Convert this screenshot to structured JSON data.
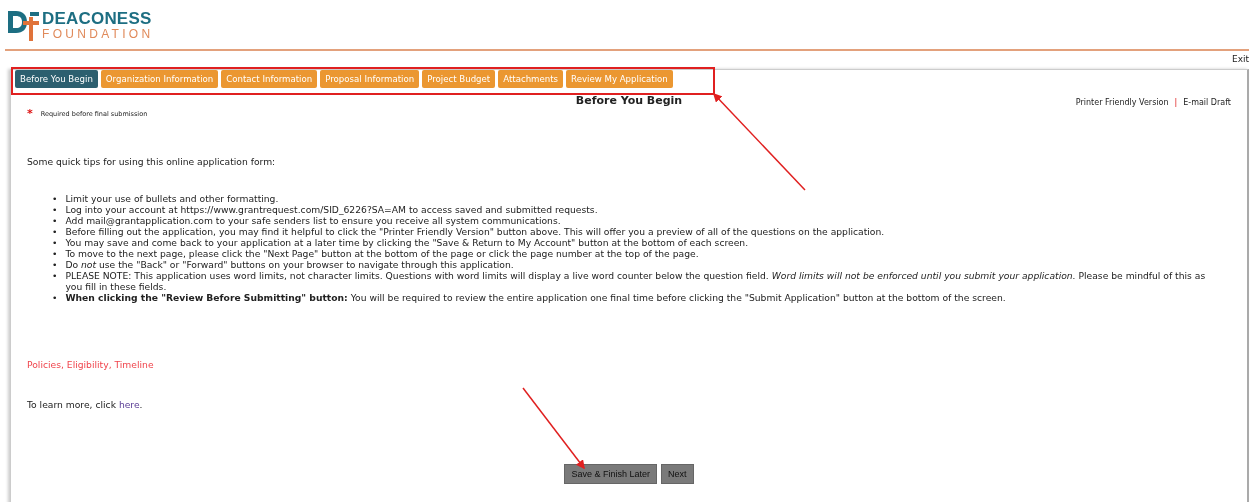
{
  "logo": {
    "name": "DEACONESS",
    "subtitle": "FOUNDATION"
  },
  "header": {
    "exit": "Exit"
  },
  "tabs": [
    {
      "label": "Before You Begin",
      "selected": true
    },
    {
      "label": "Organization Information",
      "selected": false
    },
    {
      "label": "Contact Information",
      "selected": false
    },
    {
      "label": "Proposal Information",
      "selected": false
    },
    {
      "label": "Project Budget",
      "selected": false
    },
    {
      "label": "Attachments",
      "selected": false
    },
    {
      "label": "Review My Application",
      "selected": false
    }
  ],
  "page_title": "Before You Begin",
  "page_links": [
    "Printer Friendly Version",
    "E-mail Draft"
  ],
  "links_separator": "|",
  "required_note": {
    "mark": "*",
    "text": "Required before final submission"
  },
  "intro": "Some quick tips for using this online application form:",
  "tip_bullet": "•",
  "tips": [
    "Limit your use of bullets and other formatting.",
    "Log into your account at https://www.grantrequest.com/SID_6226?SA=AM to access saved and submitted requests.",
    "Add mail@grantapplication.com to your safe senders list to ensure you receive all system communications.",
    "Before filling out the application, you may find it helpful to click the \"Printer Friendly Version\" button above. This will offer you a preview of all of the questions on the application.",
    "You may save and come back to your application at a later time by clicking the \"Save & Return to My Account\" button at the bottom of each screen.",
    "To move to the next page, please click the \"Next Page\" button at the bottom of the page or click the page number at the top of the page.",
    "Do *not* use the \"Back\" or \"Forward\" buttons on your browser to navigate through this application.",
    "PLEASE NOTE: This application uses word limits, not character limits. Questions with word limits will display a live word counter below the question field. *Word limits will not be enforced until you submit your application.* Please be mindful of this as you fill in these fields.",
    "**When clicking the \"Review Before Submitting\" button:** You will be required to review the entire application one final time before clicking the \"Submit Application\" button at the bottom of the screen."
  ],
  "policies_link": "Policies, Eligibility, Timeline",
  "learn_more": {
    "text": "To learn more, click",
    "link": "here",
    "end": "."
  },
  "buttons": [
    "Save & Finish Later",
    "Next"
  ]
}
